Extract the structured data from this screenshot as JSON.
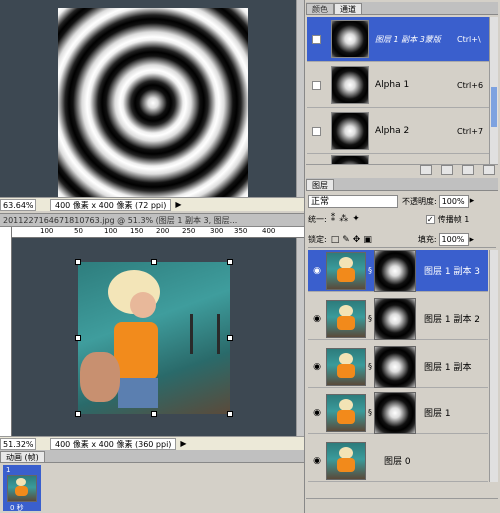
{
  "top_window": {
    "zoom": "63.64%",
    "doc_info": "400 像素 x 400 像素 (72 ppi)"
  },
  "bottom_window": {
    "title": "20112271646718107​63.jpg @ 51.3% (图层 1 副本 3, 图层...",
    "zoom": "51.32%",
    "doc_info": "400 像素 x 400 像素 (360 ppi)",
    "ruler_ticks": [
      "100",
      "50",
      "100",
      "150",
      "200",
      "250",
      "300",
      "350",
      "400"
    ]
  },
  "channels_panel": {
    "tabs": [
      "颜色",
      "通道"
    ],
    "rows": [
      {
        "name": "图层 1 副本 3蒙版",
        "shortcut": "Ctrl+\\",
        "selected": true
      },
      {
        "name": "Alpha 1",
        "shortcut": "Ctrl+6",
        "selected": false
      },
      {
        "name": "Alpha 2",
        "shortcut": "Ctrl+7",
        "selected": false
      }
    ]
  },
  "layers_panel": {
    "tab": "图层",
    "blend_mode": "正常",
    "opacity_label": "不透明度:",
    "opacity_value": "100%",
    "unify_label": "统一:",
    "propagate_label": "传播帧 1",
    "lock_label": "锁定:",
    "fill_label": "填充:",
    "fill_value": "100%",
    "layers": [
      {
        "name": "图层 1 副本 3",
        "selected": true
      },
      {
        "name": "图层 1 副本 2",
        "selected": false
      },
      {
        "name": "图层 1 副本",
        "selected": false
      },
      {
        "name": "图层 1",
        "selected": false
      },
      {
        "name": "图层 0",
        "selected": false
      }
    ]
  },
  "animation_panel": {
    "tab": "动画 (帧)",
    "frame_number": "1",
    "frame_time": "0 秒"
  },
  "colors": {
    "canvas_bg": "#3d4852",
    "selection": "#3a5fcd"
  }
}
